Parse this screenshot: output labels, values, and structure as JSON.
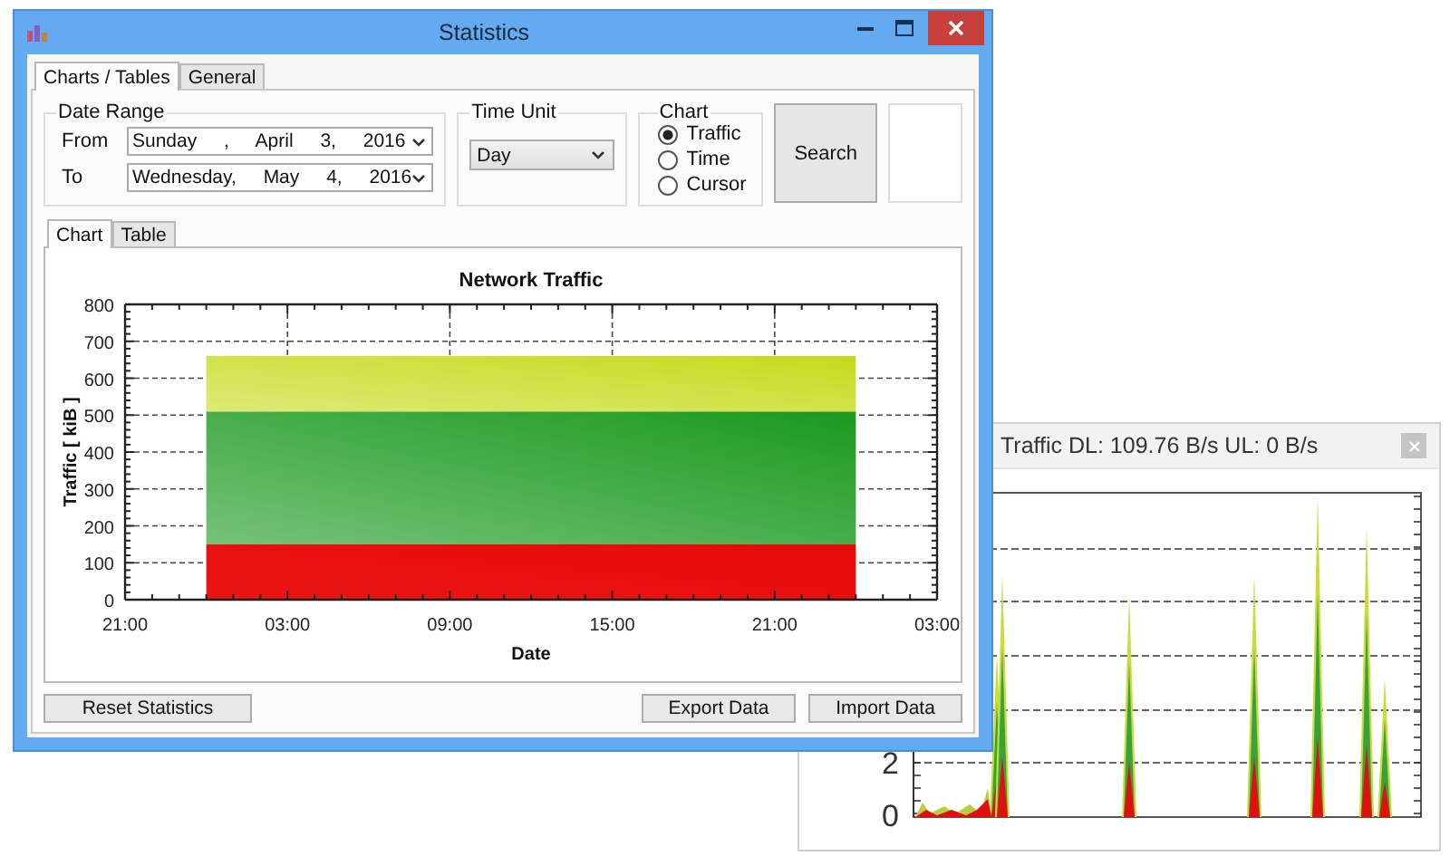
{
  "main_window": {
    "title": "Statistics",
    "tabs": [
      {
        "label": "Charts / Tables",
        "selected": true
      },
      {
        "label": "General",
        "selected": false
      }
    ],
    "date_range": {
      "label": "Date Range",
      "rows": [
        {
          "label": "From",
          "value": "Sunday , April 3, 2016"
        },
        {
          "label": "To",
          "value": "Wednesday, May 4, 2016"
        }
      ]
    },
    "time_unit": {
      "label": "Time Unit",
      "value": "Day"
    },
    "chart_type": {
      "label": "Chart",
      "options": [
        {
          "label": "Traffic",
          "selected": true
        },
        {
          "label": "Time",
          "selected": false
        },
        {
          "label": "Cursor",
          "selected": false
        }
      ]
    },
    "search_button": "Search",
    "view_tabs": [
      {
        "label": "Chart",
        "selected": true
      },
      {
        "label": "Table",
        "selected": false
      }
    ],
    "chart_data": {
      "type": "area",
      "title": "Network Traffic",
      "xlabel": "Date",
      "ylabel": "Traffic [ kiB ]",
      "stacked": true,
      "grid": true,
      "categories": [
        "21:00",
        null,
        null,
        null,
        null,
        null,
        "03:00",
        null,
        null,
        null,
        null,
        null,
        "09:00",
        null,
        null,
        null,
        null,
        null,
        "15:00",
        null,
        null,
        null,
        null,
        null,
        "21:00",
        null,
        null,
        null,
        null,
        null,
        "03:00"
      ],
      "series": [
        {
          "color": "#e80a0a",
          "values": [
            null,
            null,
            null,
            150,
            150,
            150,
            150,
            150,
            150,
            150,
            150,
            150,
            150,
            150,
            150,
            150,
            150,
            150,
            150,
            150,
            150,
            150,
            150,
            150,
            150,
            150,
            150,
            150,
            null,
            null,
            null
          ]
        },
        {
          "color": "#1a9a1e",
          "values": [
            null,
            null,
            null,
            360,
            360,
            360,
            360,
            360,
            360,
            360,
            360,
            360,
            360,
            360,
            360,
            360,
            360,
            360,
            360,
            360,
            360,
            360,
            360,
            360,
            360,
            360,
            360,
            360,
            null,
            null,
            null
          ]
        },
        {
          "color": "#c4dc1c",
          "values": [
            null,
            null,
            null,
            150,
            150,
            150,
            150,
            150,
            150,
            150,
            150,
            150,
            150,
            150,
            150,
            150,
            150,
            150,
            150,
            150,
            150,
            150,
            150,
            150,
            150,
            150,
            150,
            150,
            null,
            null,
            null
          ]
        }
      ],
      "ylim": [
        0,
        800
      ],
      "yticks": [
        0,
        100,
        200,
        300,
        400,
        500,
        600,
        700,
        800
      ]
    },
    "buttons": {
      "reset": "Reset Statistics",
      "export": "Export Data",
      "import": "Import Data"
    }
  },
  "traffic_window": {
    "title": "Traffic DL: 109.76 B/s UL: 0 B/s",
    "y_labels": [
      "2",
      "0"
    ]
  }
}
